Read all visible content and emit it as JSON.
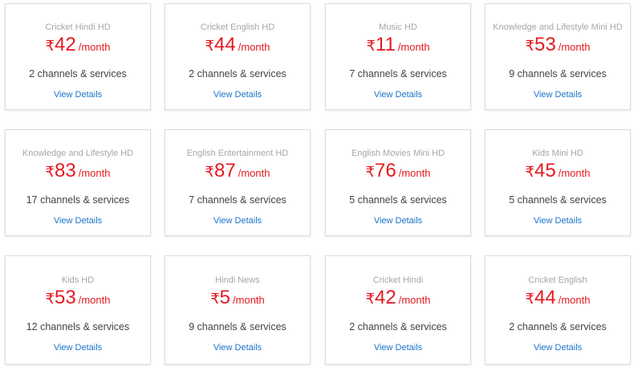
{
  "currency_symbol": "₹",
  "period_label": "/month",
  "details_label": "View Details",
  "colors": {
    "price": "#e4191f",
    "link": "#1a73c9",
    "pack_name": "#a6a6a6"
  },
  "packs": [
    {
      "name": "Cricket Hindi HD",
      "price": "42",
      "channels": "2 channels & services"
    },
    {
      "name": "Cricket English HD",
      "price": "44",
      "channels": "2 channels & services"
    },
    {
      "name": "Music HD",
      "price": "11",
      "channels": "7 channels & services"
    },
    {
      "name": "Knowledge and Lifestyle Mini HD",
      "price": "53",
      "channels": "9 channels & services"
    },
    {
      "name": "Knowledge and Lifestyle HD",
      "price": "83",
      "channels": "17 channels & services"
    },
    {
      "name": "English Entertainment HD",
      "price": "87",
      "channels": "7 channels & services"
    },
    {
      "name": "English Movies Mini HD",
      "price": "76",
      "channels": "5 channels & services"
    },
    {
      "name": "Kids Mini HD",
      "price": "45",
      "channels": "5 channels & services"
    },
    {
      "name": "Kids HD",
      "price": "53",
      "channels": "12 channels & services"
    },
    {
      "name": "Hindi News",
      "price": "5",
      "channels": "9 channels & services"
    },
    {
      "name": "Cricket Hindi",
      "price": "42",
      "channels": "2 channels & services"
    },
    {
      "name": "Cricket English",
      "price": "44",
      "channels": "2 channels & services"
    }
  ]
}
